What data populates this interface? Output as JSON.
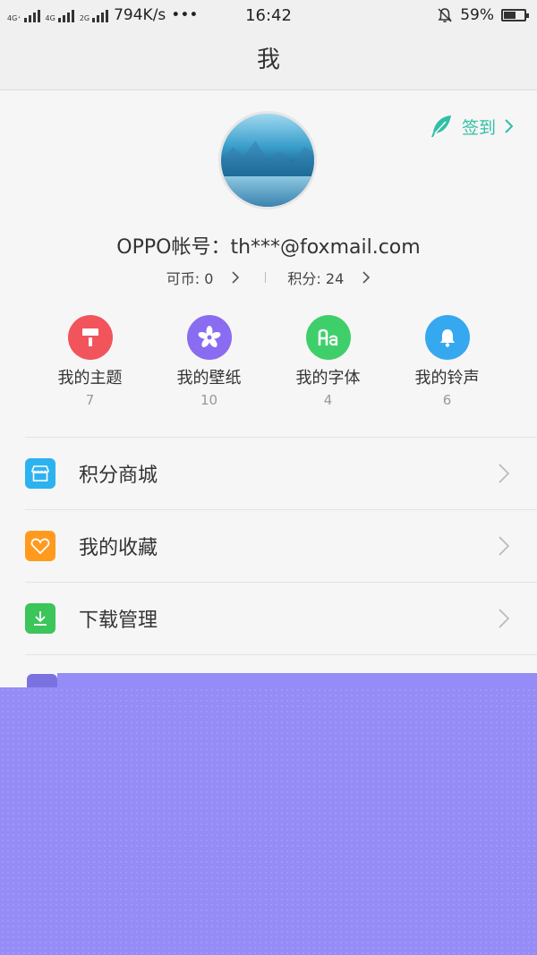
{
  "status_bar": {
    "net_tags": [
      "4G⁺",
      "4G",
      "2G"
    ],
    "speed": "794K/s",
    "dots": "•••",
    "time": "16:42",
    "battery": "59%",
    "battery_level": 0.59
  },
  "header": {
    "title": "我"
  },
  "checkin": {
    "label": "签到"
  },
  "profile": {
    "account": "OPPO帐号：th***@foxmail.com",
    "coins_label": "可币: 0",
    "points_label": "积分: 24"
  },
  "quick_items": [
    {
      "label": "我的主题",
      "count": "7",
      "color": "#f2545b",
      "icon": "brush-icon"
    },
    {
      "label": "我的壁纸",
      "count": "10",
      "color": "#8a6cf0",
      "icon": "flower-icon"
    },
    {
      "label": "我的字体",
      "count": "4",
      "color": "#3fcf6a",
      "icon": "font-icon"
    },
    {
      "label": "我的铃声",
      "count": "6",
      "color": "#35a8ef",
      "icon": "bell-icon"
    }
  ],
  "menu": [
    {
      "label": "积分商城",
      "color": "#2db2f0",
      "icon": "store-icon"
    },
    {
      "label": "我的收藏",
      "color": "#ff9a1f",
      "icon": "heart-icon"
    },
    {
      "label": "下载管理",
      "color": "#3bc55a",
      "icon": "download-icon"
    }
  ],
  "colors": {
    "accent": "#30bfa6",
    "overlay": "#958cf7"
  }
}
